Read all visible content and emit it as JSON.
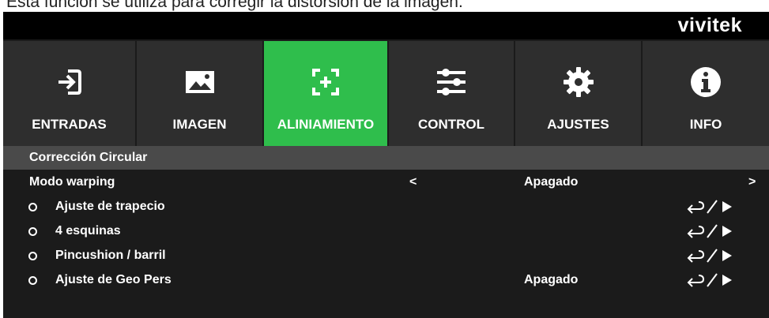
{
  "caption": "Esta función se utiliza para corregir la distorsión de la imagen.",
  "brand": "vivitek",
  "tabs": [
    {
      "label": "ENTRADAS",
      "icon": "input-icon",
      "active": false
    },
    {
      "label": "IMAGEN",
      "icon": "image-icon",
      "active": false
    },
    {
      "label": "ALINIAMIENTO",
      "icon": "alignment-icon",
      "active": true
    },
    {
      "label": "CONTROL",
      "icon": "sliders-icon",
      "active": false
    },
    {
      "label": "AJUSTES",
      "icon": "gear-icon",
      "active": false
    },
    {
      "label": "INFO",
      "icon": "info-icon",
      "active": false
    }
  ],
  "colors": {
    "active_tab": "#2fbe4c",
    "tab": "#2e2e2e",
    "background": "#1b1b1b",
    "header_row": "#4a4a4a"
  },
  "menu": {
    "header": "Corrección Circular",
    "warping": {
      "label": "Modo warping",
      "prev": "<",
      "value": "Apagado",
      "next": ">"
    },
    "items": [
      {
        "label": "Ajuste de trapecio",
        "value": ""
      },
      {
        "label": "4 esquinas",
        "value": ""
      },
      {
        "label": "Pincushion / barril",
        "value": ""
      },
      {
        "label": "Ajuste de Geo Pers",
        "value": "Apagado"
      }
    ]
  }
}
